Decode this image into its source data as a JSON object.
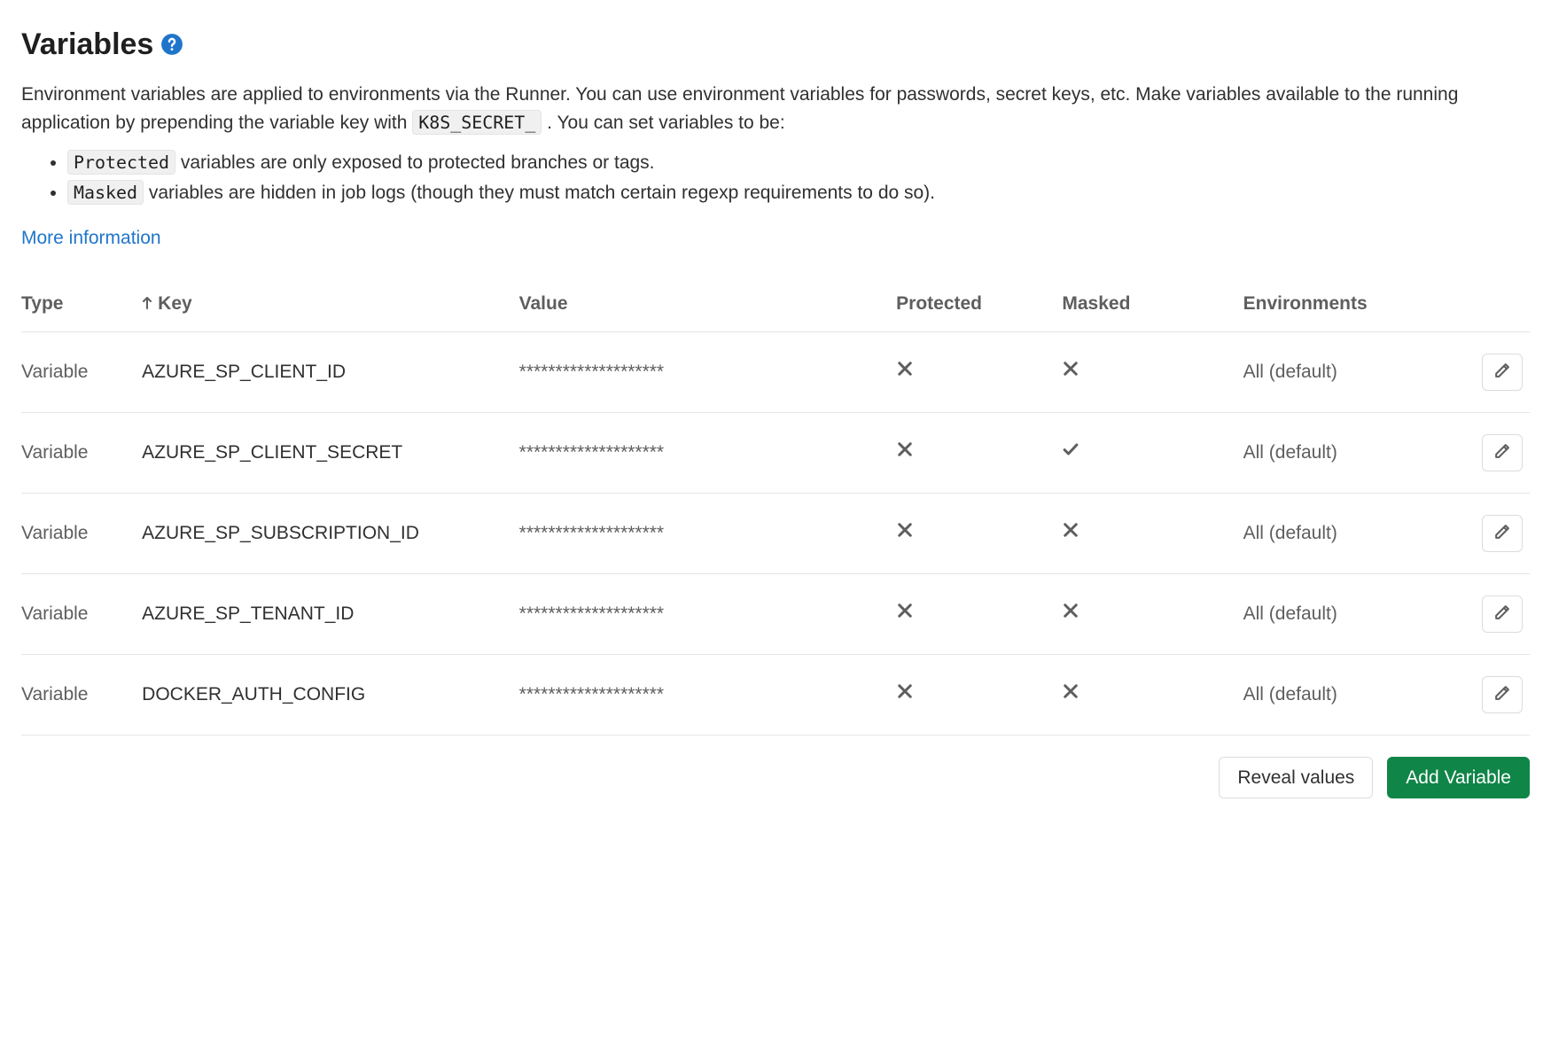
{
  "heading": "Variables",
  "description": {
    "pre": "Environment variables are applied to environments via the Runner. You can use environment variables for passwords, secret keys, etc. Make variables available to the running application by prepending the variable key with ",
    "code": "K8S_SECRET_",
    "post": ". You can set variables to be:"
  },
  "bullets": [
    {
      "code": "Protected",
      "text": " variables are only exposed to protected branches or tags."
    },
    {
      "code": "Masked",
      "text": " variables are hidden in job logs (though they must match certain regexp requirements to do so)."
    }
  ],
  "more_info_label": "More information",
  "columns": {
    "type": "Type",
    "key": "Key",
    "value": "Value",
    "protected": "Protected",
    "masked": "Masked",
    "environments": "Environments"
  },
  "rows": [
    {
      "type": "Variable",
      "key": "AZURE_SP_CLIENT_ID",
      "value": "********************",
      "protected": false,
      "masked": false,
      "environments": "All (default)"
    },
    {
      "type": "Variable",
      "key": "AZURE_SP_CLIENT_SECRET",
      "value": "********************",
      "protected": false,
      "masked": true,
      "environments": "All (default)"
    },
    {
      "type": "Variable",
      "key": "AZURE_SP_SUBSCRIPTION_ID",
      "value": "********************",
      "protected": false,
      "masked": false,
      "environments": "All (default)"
    },
    {
      "type": "Variable",
      "key": "AZURE_SP_TENANT_ID",
      "value": "********************",
      "protected": false,
      "masked": false,
      "environments": "All (default)"
    },
    {
      "type": "Variable",
      "key": "DOCKER_AUTH_CONFIG",
      "value": "********************",
      "protected": false,
      "masked": false,
      "environments": "All (default)"
    }
  ],
  "footer": {
    "reveal": "Reveal values",
    "add": "Add Variable"
  }
}
